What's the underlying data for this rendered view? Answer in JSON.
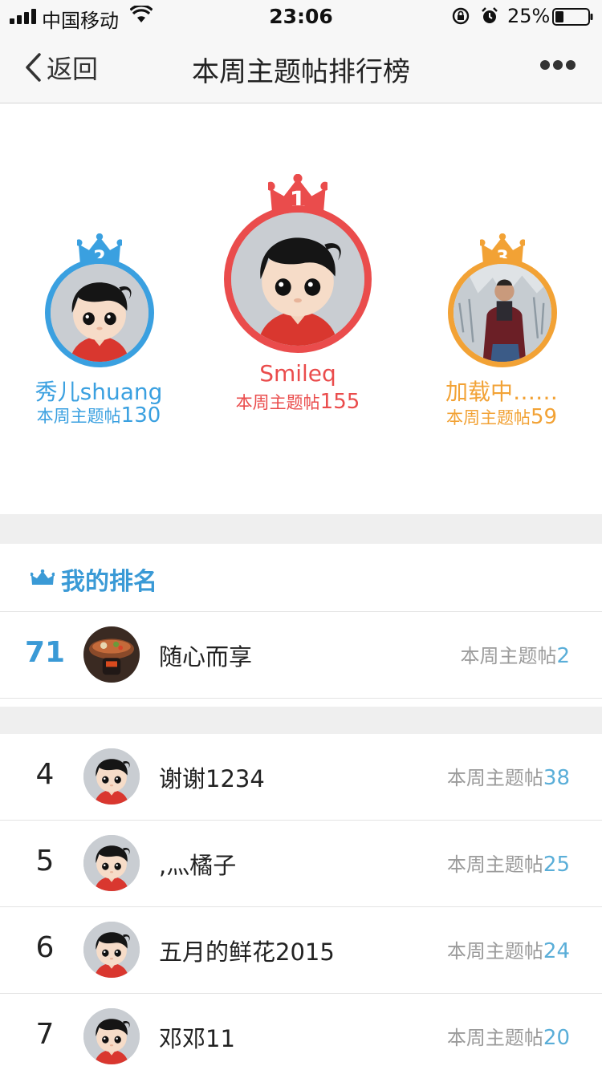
{
  "status_bar": {
    "carrier": "中国移动",
    "time": "23:06",
    "battery": "25%"
  },
  "nav": {
    "back_label": "返回",
    "title": "本周主题帖排行榜"
  },
  "podium": [
    {
      "rank": "2",
      "name": "秀儿shuang",
      "label": "本周主题帖",
      "count": "130",
      "color": "#3aa0e0"
    },
    {
      "rank": "1",
      "name": "Smileq",
      "label": "本周主题帖",
      "count": "155",
      "color": "#ea4c4c"
    },
    {
      "rank": "3",
      "name": "加载中……",
      "label": "本周主题帖",
      "count": "59",
      "color": "#f2a235"
    }
  ],
  "my_rank": {
    "title": "我的排名",
    "rank": "71",
    "name": "随心而享",
    "label": "本周主题帖",
    "count": "2"
  },
  "list": [
    {
      "rank": "4",
      "name": "谢谢1234",
      "label": "本周主题帖",
      "count": "38"
    },
    {
      "rank": "5",
      "name": ",灬橘子",
      "label": "本周主题帖",
      "count": "25"
    },
    {
      "rank": "6",
      "name": "五月的鲜花2015",
      "label": "本周主题帖",
      "count": "24"
    },
    {
      "rank": "7",
      "name": "邓邓11",
      "label": "本周主题帖",
      "count": "20"
    }
  ],
  "colors": {
    "accent": "#3a9ad6",
    "gold": "#ea4c4c",
    "silver": "#3aa0e0",
    "bronze": "#f2a235"
  }
}
